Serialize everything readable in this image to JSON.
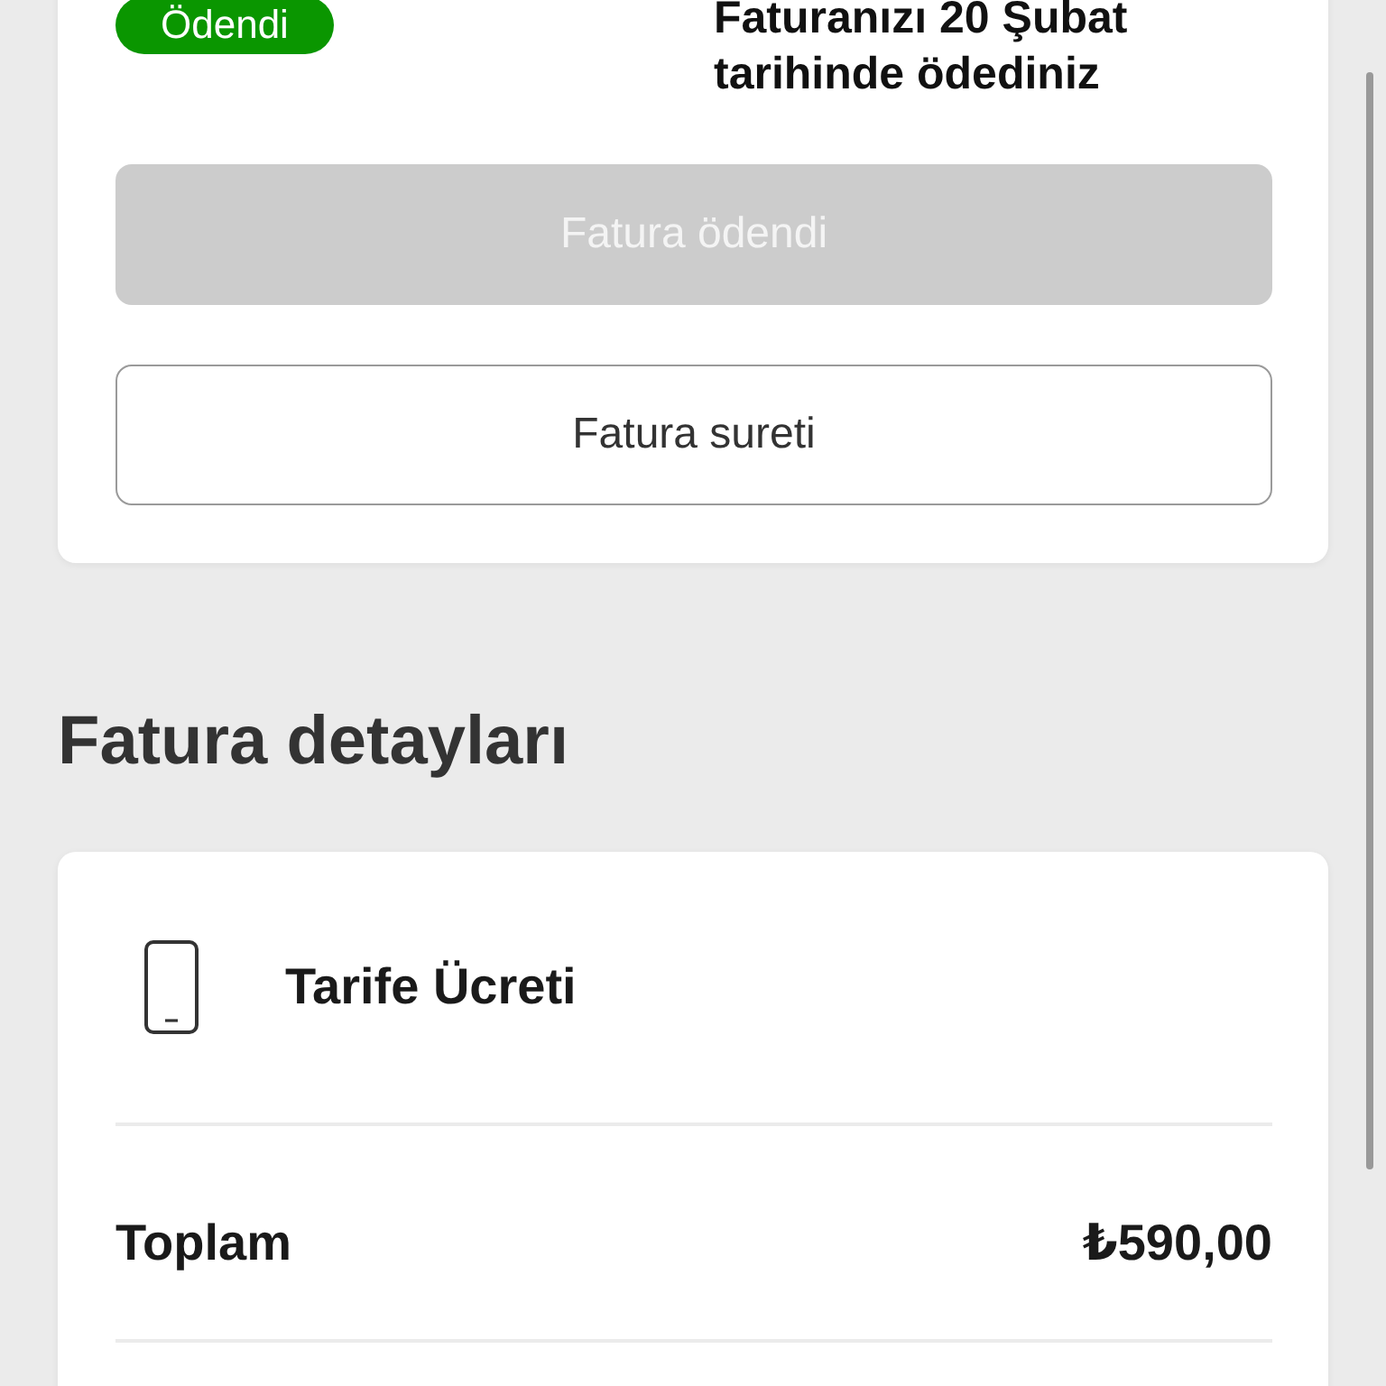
{
  "bill_card": {
    "status_badge": "Ödendi",
    "message": "Faturanızı 20 Şubat tarihinde ödediniz",
    "buttons": [
      {
        "label": "Fatura ödendi",
        "disabled": true
      },
      {
        "label": "Fatura sureti",
        "disabled": false
      }
    ]
  },
  "details": {
    "title": "Fatura detayları",
    "items": [
      {
        "kind": "charge",
        "label": "Tarife Ücreti"
      },
      {
        "kind": "total",
        "label": "Toplam",
        "amount": "₺590,00"
      }
    ]
  }
}
